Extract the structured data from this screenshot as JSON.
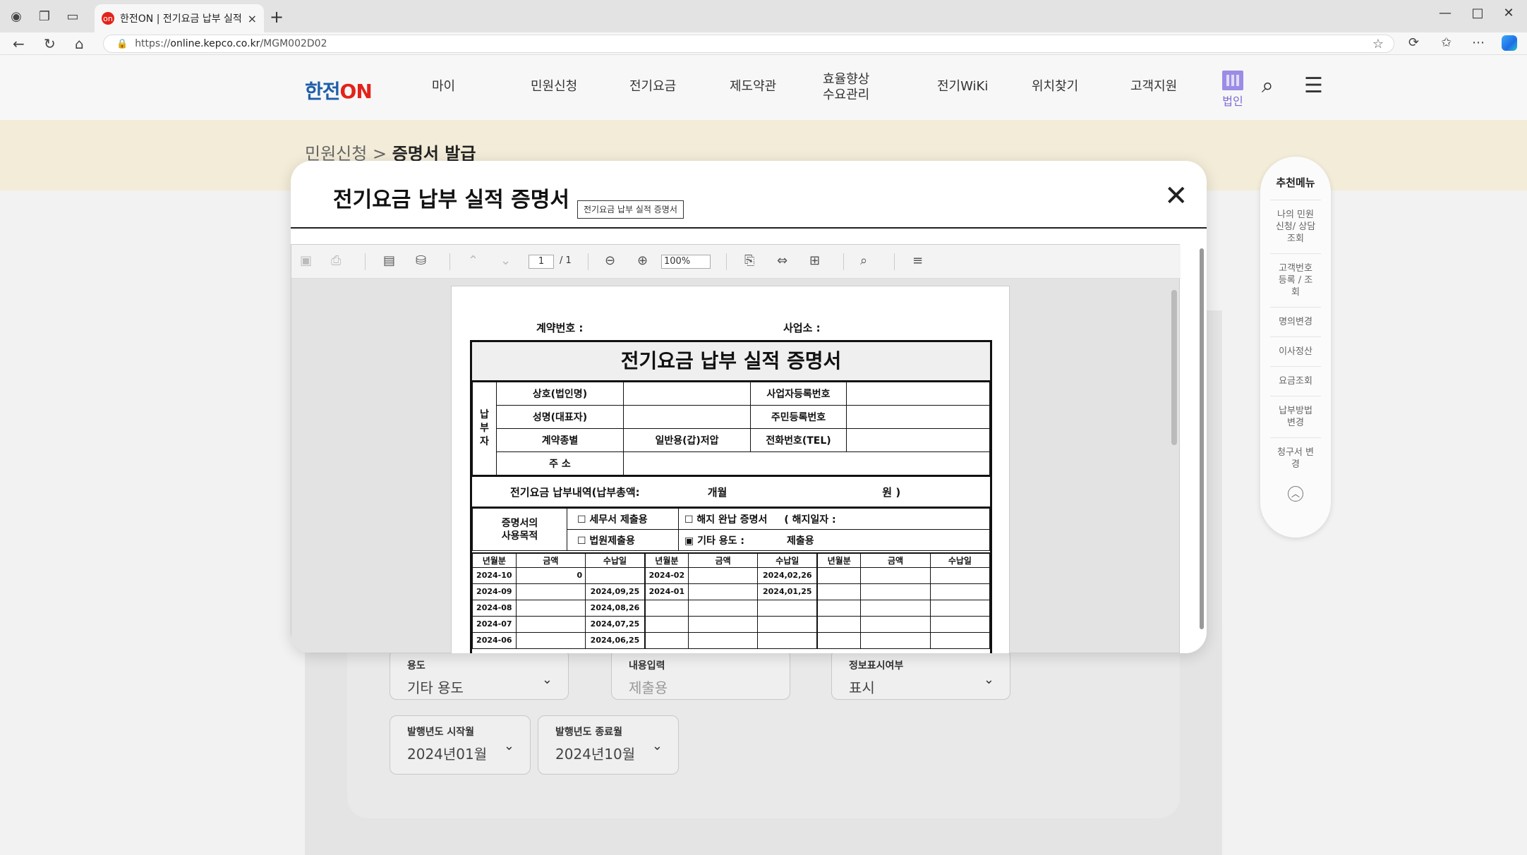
{
  "browser": {
    "tab_title": "한전ON | 전기요금 납부 실적 증명",
    "favicon_text": "on",
    "url_scheme": "https://",
    "url_host": "online.kepco.co.kr",
    "url_path": "/MGM002D02"
  },
  "site": {
    "logo_main": "한전",
    "logo_accent": "ON",
    "nav": [
      "마이",
      "민원신청",
      "전기요금",
      "제도약관",
      "효율향상",
      "수요관리",
      "전기WiKi",
      "위치찾기",
      "고객지원"
    ],
    "corp_label": "법인"
  },
  "breadcrumb": {
    "parent": "민원신청",
    "current": "증명서 발급"
  },
  "form": {
    "use_label": "용도",
    "use_value": "기타 용도",
    "content_label": "내용입력",
    "content_value": "제출용",
    "info_label": "정보표시여부",
    "info_value": "표시",
    "start_label": "발행년도 시작월",
    "start_value": "2024년01월",
    "end_label": "발행년도 종료월",
    "end_value": "2024년10월"
  },
  "quick_menu": {
    "title": "추천메뉴",
    "items": [
      "나의 민원신청/ 상담조회",
      "고객번호 등록 / 조회",
      "명의변경",
      "이사정산",
      "요금조회",
      "납부방법 변경",
      "청구서 변경"
    ]
  },
  "modal": {
    "title": "전기요금 납부 실적 증명서",
    "tag": "전기요금 납부 실적 증명서",
    "close": "✕"
  },
  "viewer": {
    "page_current": "1",
    "page_total": "/ 1",
    "zoom": "100%"
  },
  "document": {
    "contract_no_label": "계약번호 :",
    "office_label": "사업소 :",
    "title": "전기요금 납부 실적 증명서",
    "payer_label": "납부자",
    "rows": {
      "company": "상호(법인명)",
      "bizno": "사업자등록번호",
      "name": "성명(대표자)",
      "resno": "주민등록번호",
      "contract_type": "계약종별",
      "contract_type_value": "일반용(갑)저압",
      "tel": "전화번호(TEL)",
      "address": "주 소"
    },
    "total": {
      "label": "전기요금 납부내역(납부총액:",
      "months": "개월",
      "won": "원 )"
    },
    "purpose": {
      "label1": "증명서의",
      "label2": "사용목적",
      "opt1": "☐  세무서 제출용",
      "opt2": "☐  해지 완납 증명서",
      "opt2b": "( 해지일자 :",
      "opt3": "☐  법원제출용",
      "opt4": "▣  기타 용도 :",
      "opt4_value": "제출용"
    },
    "pay_headers": [
      "년월분",
      "금액",
      "수납일"
    ],
    "pay_rows": [
      [
        "2024-10",
        "0",
        "",
        "2024-02",
        "",
        "2024,02,26"
      ],
      [
        "2024-09",
        "",
        "2024,09,25",
        "2024-01",
        "",
        "2024,01,25"
      ],
      [
        "2024-08",
        "",
        "2024,08,26",
        "",
        "",
        ""
      ],
      [
        "2024-07",
        "",
        "2024,07,25",
        "",
        "",
        ""
      ],
      [
        "2024-06",
        "",
        "2024,06,25",
        "",
        "",
        ""
      ]
    ]
  }
}
